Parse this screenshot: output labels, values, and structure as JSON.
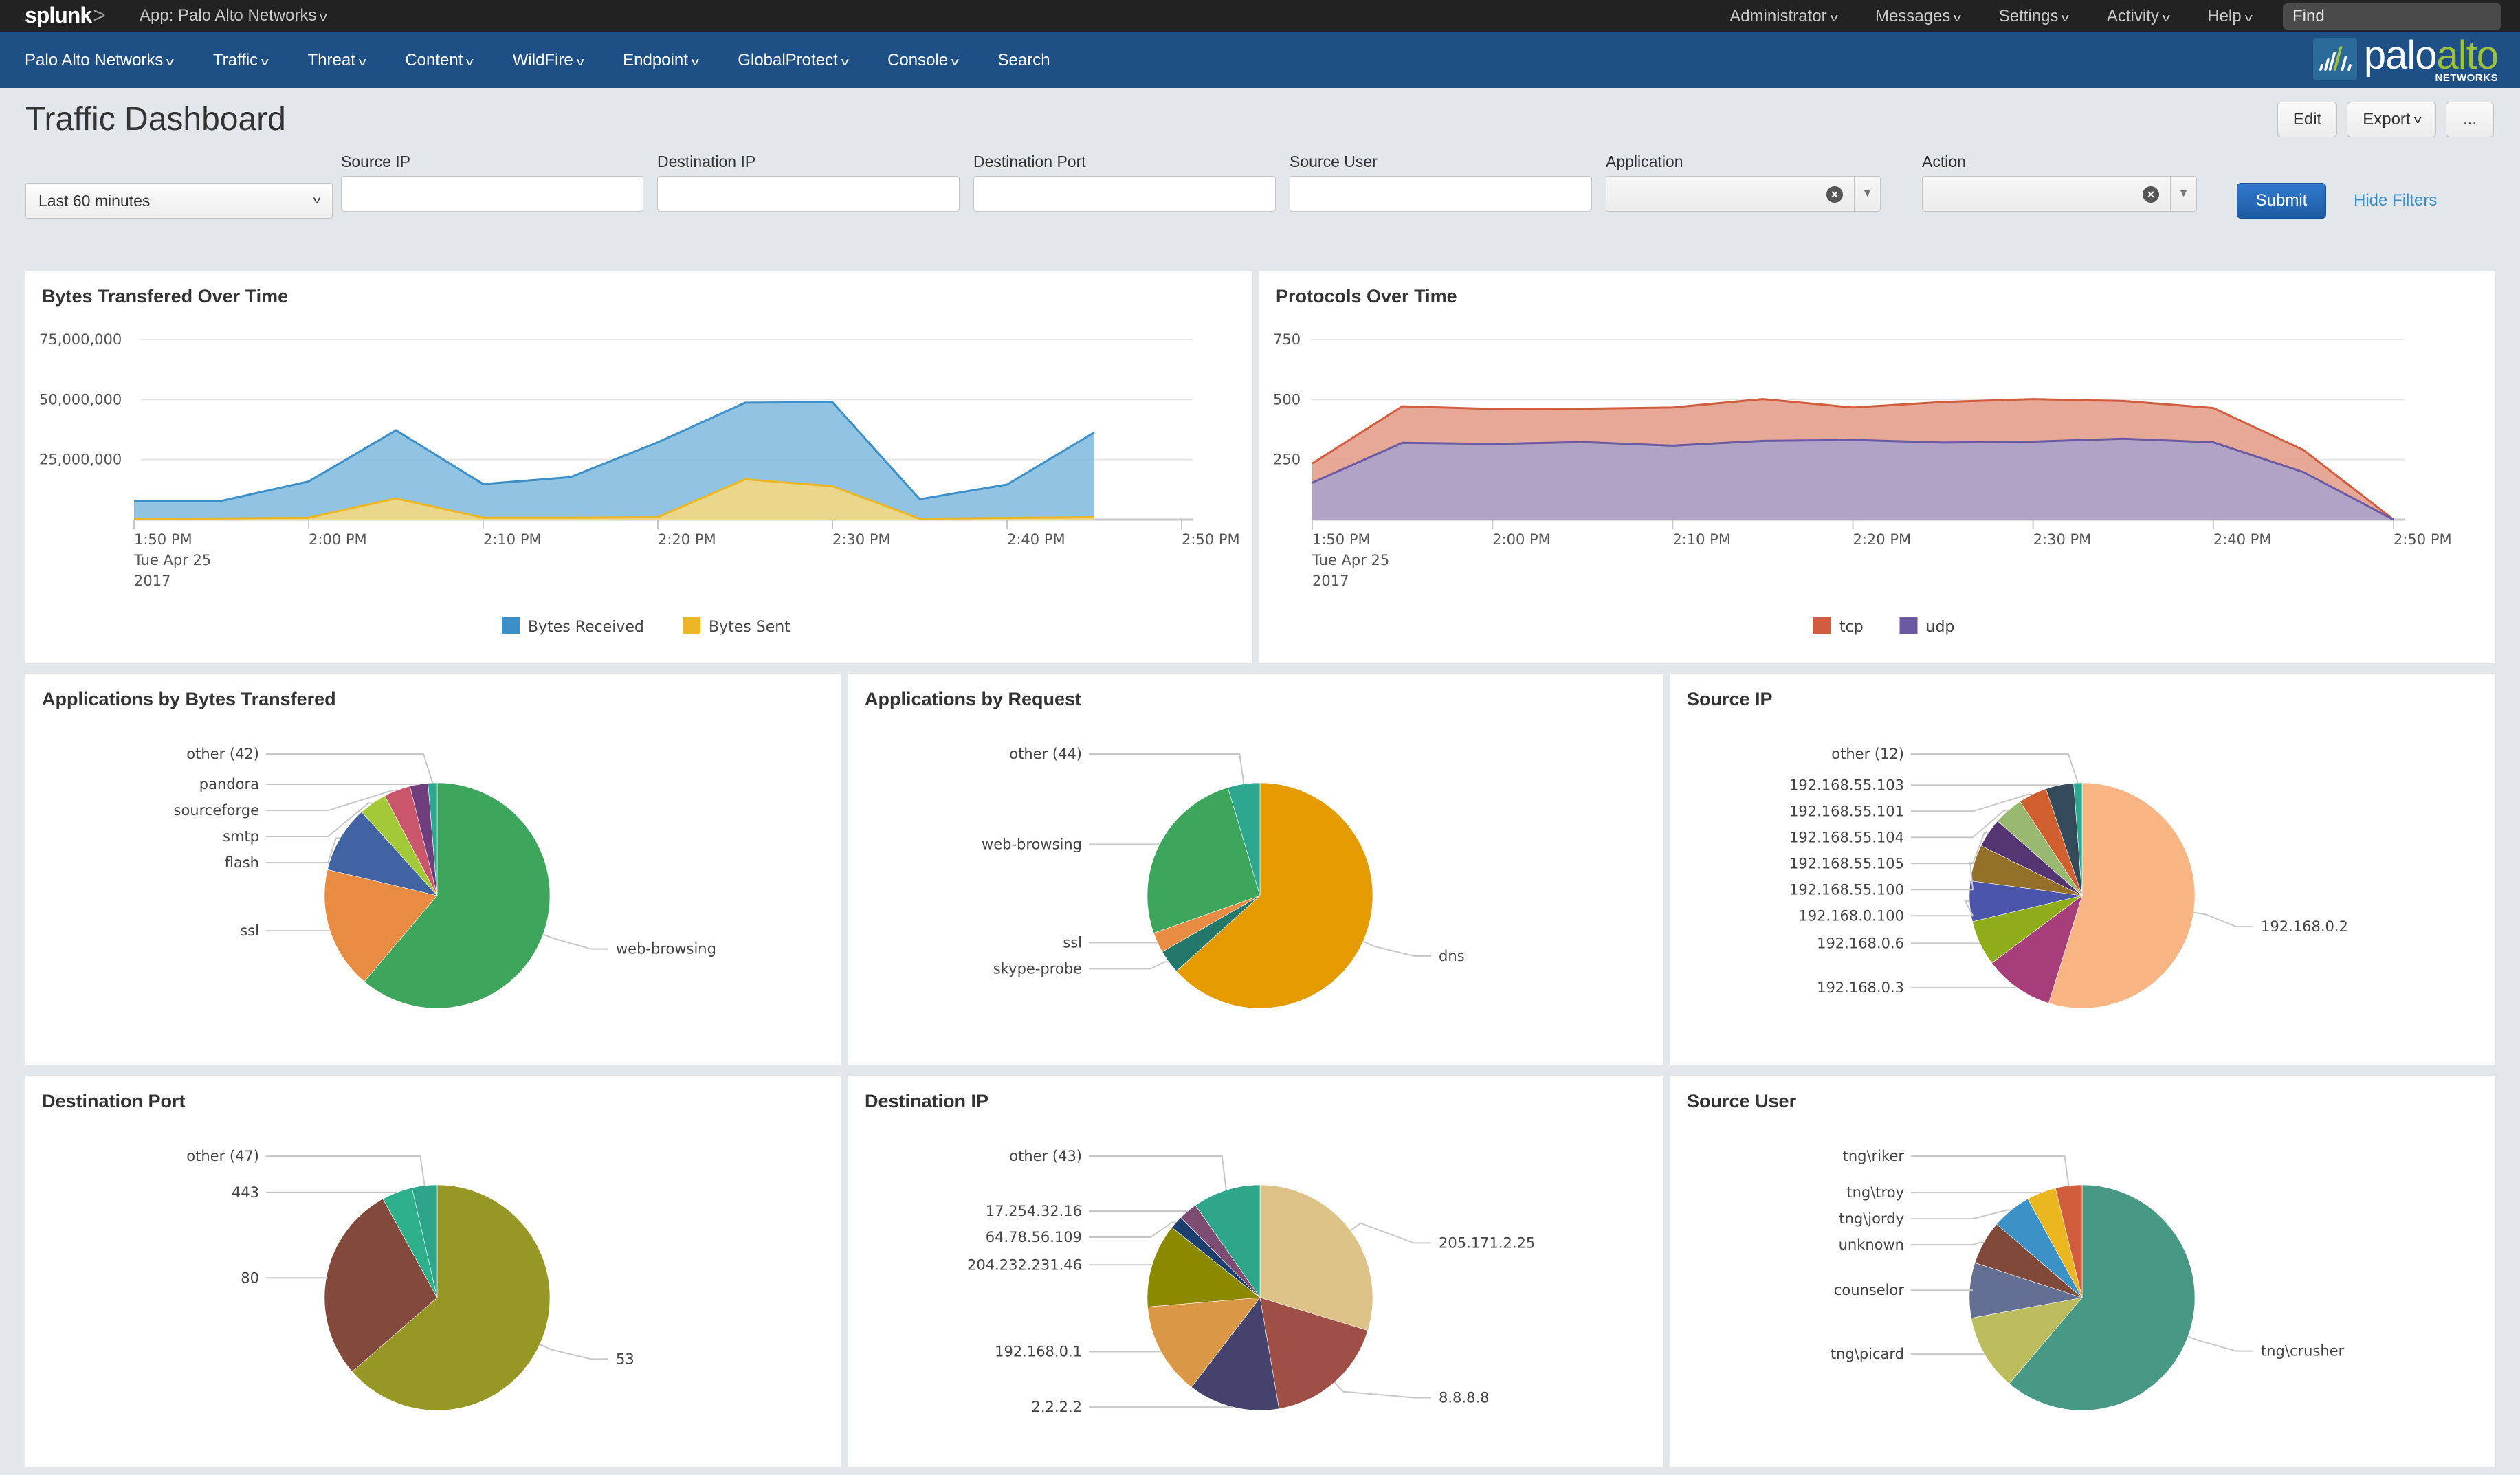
{
  "topbar": {
    "brand": "splunk",
    "app_menu": "App: Palo Alto Networks",
    "menus": [
      "Administrator",
      "Messages",
      "Settings",
      "Activity",
      "Help"
    ],
    "find_placeholder": "Find"
  },
  "nav": {
    "items": [
      {
        "label": "Palo Alto Networks",
        "dropdown": true
      },
      {
        "label": "Traffic",
        "dropdown": true
      },
      {
        "label": "Threat",
        "dropdown": true
      },
      {
        "label": "Content",
        "dropdown": true
      },
      {
        "label": "WildFire",
        "dropdown": true
      },
      {
        "label": "Endpoint",
        "dropdown": true
      },
      {
        "label": "GlobalProtect",
        "dropdown": true
      },
      {
        "label": "Console",
        "dropdown": true
      },
      {
        "label": "Search",
        "dropdown": false
      }
    ],
    "logo": {
      "palo": "palo",
      "alto": "alto",
      "networks": "NETWORKS"
    }
  },
  "page": {
    "title": "Traffic Dashboard",
    "actions": {
      "edit": "Edit",
      "export": "Export",
      "more": "..."
    }
  },
  "filters": {
    "time_range": "Last 60 minutes",
    "fields": [
      {
        "label": "Source IP",
        "value": ""
      },
      {
        "label": "Destination IP",
        "value": ""
      },
      {
        "label": "Destination Port",
        "value": ""
      },
      {
        "label": "Source User",
        "value": ""
      }
    ],
    "combos": [
      {
        "label": "Application",
        "value": ""
      },
      {
        "label": "Action",
        "value": ""
      }
    ],
    "submit": "Submit",
    "hide_filters": "Hide Filters"
  },
  "colors": {
    "topbar": "#222222",
    "navbar": "#1e5086",
    "submit": "#2566b0",
    "link": "#3d8fc9"
  },
  "chart_data": [
    {
      "id": "bytes",
      "type": "area",
      "title": "Bytes Transfered Over Time",
      "x": [
        "1:50 PM",
        "1:55 PM",
        "2:00 PM",
        "2:05 PM",
        "2:10 PM",
        "2:15 PM",
        "2:20 PM",
        "2:25 PM",
        "2:30 PM",
        "2:35 PM",
        "2:40 PM",
        "2:45 PM"
      ],
      "xticks": [
        "1:50 PM",
        "2:00 PM",
        "2:10 PM",
        "2:20 PM",
        "2:30 PM",
        "2:40 PM",
        "2:50 PM"
      ],
      "xdate": [
        "Tue Apr 25",
        "2017"
      ],
      "yticks": [
        "25,000,000",
        "50,000,000",
        "75,000,000"
      ],
      "ylim": [
        0,
        75000000
      ],
      "series": [
        {
          "name": "Bytes Received",
          "color": "#3c8fc7",
          "fill": "#87bfe0",
          "values": [
            7800000,
            7800000,
            15900000,
            37200000,
            14800000,
            17700000,
            32200000,
            48700000,
            48900000,
            8500000,
            14600000,
            36300000
          ]
        },
        {
          "name": "Bytes Sent",
          "color": "#ecb724",
          "fill": "#f3d883",
          "values": [
            300000,
            500000,
            800000,
            8800000,
            800000,
            800000,
            1000000,
            16800000,
            13900000,
            400000,
            700000,
            1000000
          ]
        }
      ],
      "legend": "bottom"
    },
    {
      "id": "protocols",
      "type": "area",
      "title": "Protocols Over Time",
      "x": [
        "1:50 PM",
        "1:55 PM",
        "2:00 PM",
        "2:05 PM",
        "2:10 PM",
        "2:15 PM",
        "2:20 PM",
        "2:25 PM",
        "2:30 PM",
        "2:35 PM",
        "2:40 PM",
        "2:45 PM",
        "2:50 PM"
      ],
      "xticks": [
        "1:50 PM",
        "2:00 PM",
        "2:10 PM",
        "2:20 PM",
        "2:30 PM",
        "2:40 PM",
        "2:50 PM"
      ],
      "xdate": [
        "Tue Apr 25",
        "2017"
      ],
      "yticks": [
        "250",
        "500",
        "750"
      ],
      "ylim": [
        0,
        750
      ],
      "series": [
        {
          "name": "tcp",
          "color": "#d25c3e",
          "fill": "#e4a18e",
          "values": [
            234,
            472,
            461,
            462,
            467,
            502,
            467,
            490,
            502,
            494,
            465,
            290,
            0
          ]
        },
        {
          "name": "udp",
          "color": "#6a5aa4",
          "fill": "#aba3c9",
          "values": [
            154,
            320,
            315,
            323,
            308,
            328,
            332,
            321,
            325,
            337,
            322,
            198,
            0
          ]
        }
      ],
      "legend": "bottom"
    },
    {
      "id": "apps-bytes",
      "type": "pie",
      "title": "Applications by Bytes Transfered",
      "slices": [
        {
          "label": "web-browsing",
          "value": 61.2,
          "color": "#3ea55d"
        },
        {
          "label": "ssl",
          "value": 17.5,
          "color": "#e88c43"
        },
        {
          "label": "flash",
          "value": 9.6,
          "color": "#4163a1"
        },
        {
          "label": "smtp",
          "value": 4.0,
          "color": "#a3c838"
        },
        {
          "label": "sourceforge",
          "value": 3.8,
          "color": "#c9566b"
        },
        {
          "label": "pandora",
          "value": 2.6,
          "color": "#6f3f7d"
        },
        {
          "label": "other (42)",
          "value": 1.3,
          "color": "#2ea791"
        }
      ]
    },
    {
      "id": "apps-request",
      "type": "pie",
      "title": "Applications by Request",
      "slices": [
        {
          "label": "dns",
          "value": 63.3,
          "color": "#e59b00"
        },
        {
          "label": "skype-probe",
          "value": 3.4,
          "color": "#24786a"
        },
        {
          "label": "ssl",
          "value": 2.9,
          "color": "#e88c43"
        },
        {
          "label": "web-browsing",
          "value": 25.8,
          "color": "#3ea55d"
        },
        {
          "label": "other (44)",
          "value": 4.6,
          "color": "#2ea791"
        }
      ]
    },
    {
      "id": "source-ip",
      "type": "pie",
      "title": "Source IP",
      "slices": [
        {
          "label": "192.168.0.2",
          "value": 54.8,
          "color": "#f8b483"
        },
        {
          "label": "192.168.0.3",
          "value": 10.0,
          "color": "#a63e7a"
        },
        {
          "label": "192.168.0.6",
          "value": 6.5,
          "color": "#8fad1a"
        },
        {
          "label": "192.168.0.100",
          "value": 5.8,
          "color": "#4a55ab"
        },
        {
          "label": "192.168.55.100",
          "value": 5.2,
          "color": "#936f28"
        },
        {
          "label": "192.168.55.105",
          "value": 4.2,
          "color": "#553472"
        },
        {
          "label": "192.168.55.104",
          "value": 4.2,
          "color": "#98b96f"
        },
        {
          "label": "192.168.55.101",
          "value": 4.1,
          "color": "#d05f30"
        },
        {
          "label": "192.168.55.103",
          "value": 4.0,
          "color": "#344a5b"
        },
        {
          "label": "other (12)",
          "value": 1.2,
          "color": "#2ea791"
        }
      ]
    },
    {
      "id": "dest-port",
      "type": "pie",
      "title": "Destination Port",
      "slices": [
        {
          "label": "53",
          "value": 63.6,
          "color": "#979725"
        },
        {
          "label": "80",
          "value": 28.4,
          "color": "#82493c"
        },
        {
          "label": "443",
          "value": 4.4,
          "color": "#2fb08d"
        },
        {
          "label": "other (47)",
          "value": 3.6,
          "color": "#2ea48a"
        }
      ]
    },
    {
      "id": "dest-ip",
      "type": "pie",
      "title": "Destination IP",
      "slices": [
        {
          "label": "205.171.2.25",
          "value": 29.7,
          "color": "#ddc287"
        },
        {
          "label": "8.8.8.8",
          "value": 17.6,
          "color": "#9f4f45"
        },
        {
          "label": "2.2.2.2",
          "value": 13.1,
          "color": "#45436d"
        },
        {
          "label": "192.168.0.1",
          "value": 13.3,
          "color": "#da9846"
        },
        {
          "label": "204.232.231.46",
          "value": 12.0,
          "color": "#8b8900"
        },
        {
          "label": "64.78.56.109",
          "value": 1.9,
          "color": "#1d3f6e"
        },
        {
          "label": "17.254.32.16",
          "value": 2.7,
          "color": "#7c4c72"
        },
        {
          "label": "other (43)",
          "value": 9.7,
          "color": "#2ea68a"
        }
      ]
    },
    {
      "id": "source-user",
      "type": "pie",
      "title": "Source User",
      "slices": [
        {
          "label": "tng\\crusher",
          "value": 61.2,
          "color": "#489886"
        },
        {
          "label": "tng\\picard",
          "value": 10.9,
          "color": "#bbbc5b"
        },
        {
          "label": "counselor",
          "value": 7.9,
          "color": "#637094"
        },
        {
          "label": "unknown",
          "value": 6.3,
          "color": "#814939"
        },
        {
          "label": "tng\\jordy",
          "value": 5.7,
          "color": "#3c92c7"
        },
        {
          "label": "tng\\troy",
          "value": 4.2,
          "color": "#ebb720"
        },
        {
          "label": "tng\\riker",
          "value": 3.8,
          "color": "#d05d3c"
        }
      ]
    }
  ]
}
